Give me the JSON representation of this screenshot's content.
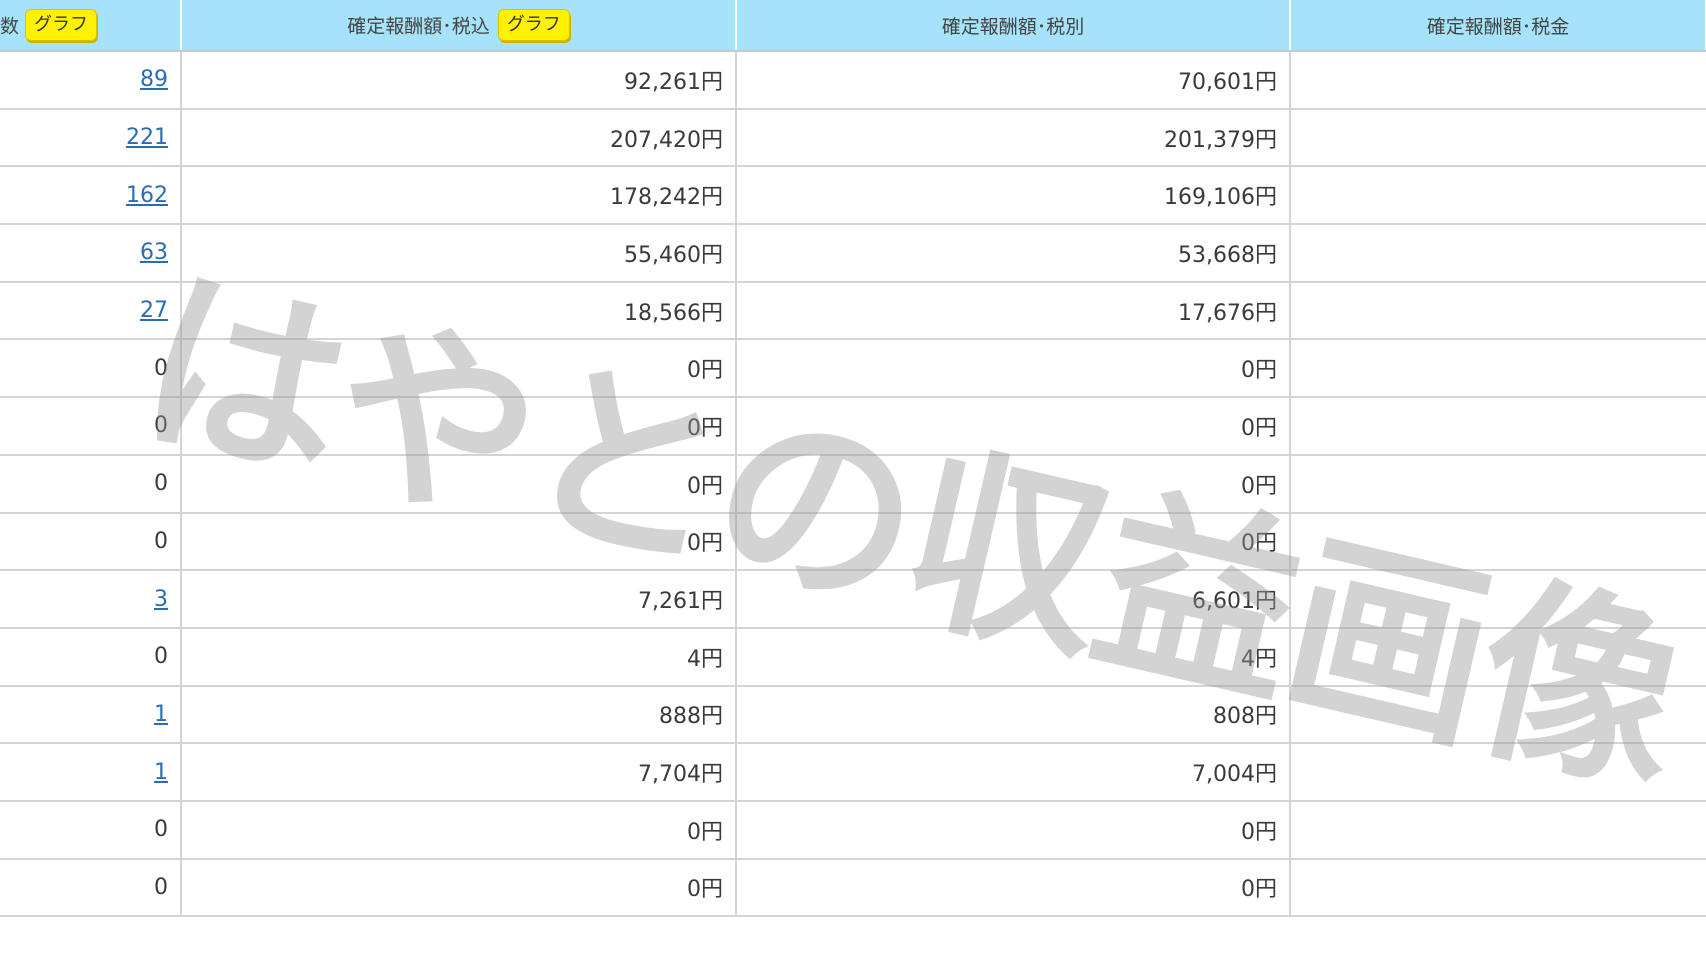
{
  "header": {
    "col0_label": "数",
    "col0_graph_button": "グラフ",
    "col1_label": "確定報酬額･税込",
    "col1_graph_button": "グラフ",
    "col2_label": "確定報酬額･税別",
    "col3_label": "確定報酬額･税金"
  },
  "rows": [
    {
      "count": "89",
      "linked": true,
      "incl": "92,261円",
      "excl": "70,601円",
      "tax": ""
    },
    {
      "count": "221",
      "linked": true,
      "incl": "207,420円",
      "excl": "201,379円",
      "tax": ""
    },
    {
      "count": "162",
      "linked": true,
      "incl": "178,242円",
      "excl": "169,106円",
      "tax": ""
    },
    {
      "count": "63",
      "linked": true,
      "incl": "55,460円",
      "excl": "53,668円",
      "tax": ""
    },
    {
      "count": "27",
      "linked": true,
      "incl": "18,566円",
      "excl": "17,676円",
      "tax": ""
    },
    {
      "count": "0",
      "linked": false,
      "incl": "0円",
      "excl": "0円",
      "tax": ""
    },
    {
      "count": "0",
      "linked": false,
      "incl": "0円",
      "excl": "0円",
      "tax": ""
    },
    {
      "count": "0",
      "linked": false,
      "incl": "0円",
      "excl": "0円",
      "tax": ""
    },
    {
      "count": "0",
      "linked": false,
      "incl": "0円",
      "excl": "0円",
      "tax": ""
    },
    {
      "count": "3",
      "linked": true,
      "incl": "7,261円",
      "excl": "6,601円",
      "tax": ""
    },
    {
      "count": "0",
      "linked": false,
      "incl": "4円",
      "excl": "4円",
      "tax": ""
    },
    {
      "count": "1",
      "linked": true,
      "incl": "888円",
      "excl": "808円",
      "tax": ""
    },
    {
      "count": "1",
      "linked": true,
      "incl": "7,704円",
      "excl": "7,004円",
      "tax": ""
    },
    {
      "count": "0",
      "linked": false,
      "incl": "0円",
      "excl": "0円",
      "tax": ""
    },
    {
      "count": "0",
      "linked": false,
      "incl": "0円",
      "excl": "0円",
      "tax": ""
    }
  ],
  "watermark": "はやとの収益画像",
  "colors": {
    "header_bg": "#a6e3fb",
    "graph_button_bg": "#fff200",
    "link": "#2a6db3",
    "grid": "#d4d4d4"
  }
}
